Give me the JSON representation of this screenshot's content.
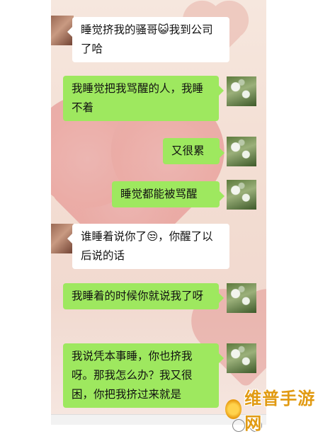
{
  "messages": [
    {
      "side": "recv",
      "text": "睡觉挤我的骚哥😺我到公司了哈"
    },
    {
      "side": "sent",
      "text": "我睡觉把我骂醒的人，我睡不着"
    },
    {
      "side": "sent",
      "text": "又很累"
    },
    {
      "side": "sent",
      "text": "睡觉都能被骂醒"
    },
    {
      "side": "recv",
      "text": "谁睡着说你了😒，你醒了以后说的话"
    },
    {
      "side": "sent",
      "text": "我睡着的时候你就说我了呀"
    },
    {
      "side": "sent",
      "text": "我说凭本事睡，你也挤我呀。那我怎么办？我又很困，你把我挤过来就是"
    }
  ],
  "watermark": {
    "text": "维普手游网"
  }
}
